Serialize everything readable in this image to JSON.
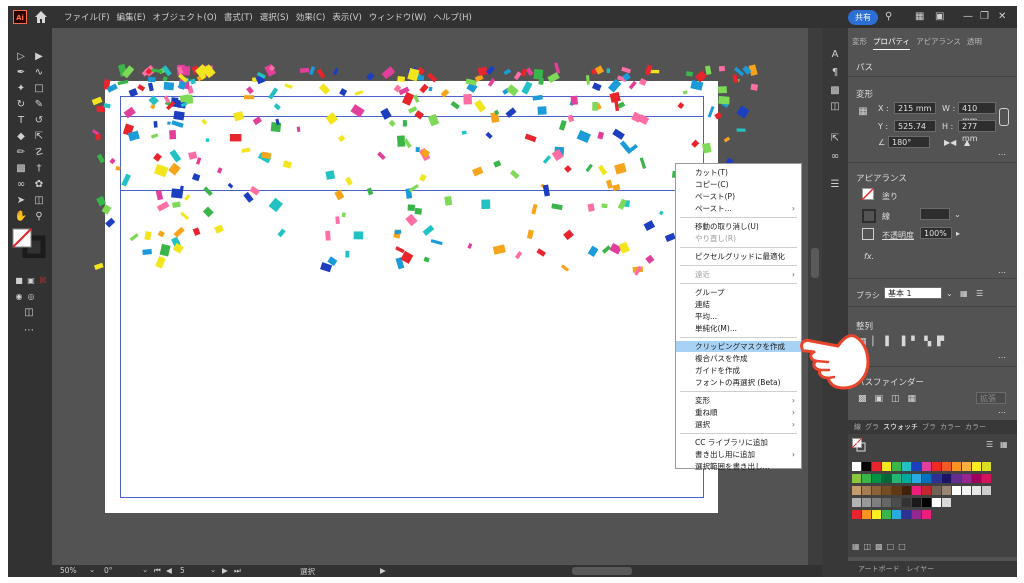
{
  "menubar": {
    "logo": "Ai",
    "menus": [
      "ファイル(F)",
      "編集(E)",
      "オブジェクト(O)",
      "書式(T)",
      "選択(S)",
      "効果(C)",
      "表示(V)",
      "ウィンドウ(W)",
      "ヘルプ(H)"
    ],
    "share": "共有"
  },
  "context_menu": {
    "items": [
      {
        "label": "カット(T)",
        "disabled": false,
        "submenu": false
      },
      {
        "label": "コピー(C)",
        "disabled": false,
        "submenu": false
      },
      {
        "label": "ペースト(P)",
        "disabled": false,
        "submenu": false
      },
      {
        "label": "ペースト...",
        "disabled": false,
        "submenu": true
      },
      {
        "label": "移動の取り消し(U)",
        "disabled": false,
        "submenu": false
      },
      {
        "label": "やり直し(R)",
        "disabled": true,
        "submenu": false
      },
      {
        "label": "ピクセルグリッドに最適化",
        "disabled": false,
        "submenu": false
      },
      {
        "label": "遠近",
        "disabled": true,
        "submenu": true
      },
      {
        "label": "グループ",
        "disabled": false,
        "submenu": false
      },
      {
        "label": "連結",
        "disabled": false,
        "submenu": false
      },
      {
        "label": "平均...",
        "disabled": false,
        "submenu": false
      },
      {
        "label": "単純化(M)...",
        "disabled": false,
        "submenu": false
      },
      {
        "label": "クリッピングマスクを作成",
        "disabled": false,
        "submenu": false,
        "highlight": true
      },
      {
        "label": "複合パスを作成",
        "disabled": false,
        "submenu": false
      },
      {
        "label": "ガイドを作成",
        "disabled": false,
        "submenu": false
      },
      {
        "label": "フォントの再選択 (Beta)",
        "disabled": false,
        "submenu": false
      },
      {
        "label": "変形",
        "disabled": false,
        "submenu": true
      },
      {
        "label": "重ね順",
        "disabled": false,
        "submenu": true
      },
      {
        "label": "選択",
        "disabled": false,
        "submenu": true
      },
      {
        "label": "CC ライブラリに追加",
        "disabled": false,
        "submenu": false
      },
      {
        "label": "書き出し用に追加",
        "disabled": false,
        "submenu": true
      },
      {
        "label": "選択範囲を書き出し...",
        "disabled": false,
        "submenu": false
      }
    ]
  },
  "properties": {
    "tabs": [
      "変形",
      "プロパティ",
      "アピアランス",
      "透明"
    ],
    "section_path": "パス",
    "transform_title": "変形",
    "x_label": "X :",
    "x_value": "215 mm",
    "y_label": "Y :",
    "y_value": "525.74",
    "w_label": "W :",
    "w_value": "410 mm",
    "h_label": "H :",
    "h_value": "277 mm",
    "angle_value": "180°",
    "appearance_title": "アピアランス",
    "fill_label": "塗り",
    "stroke_label": "線",
    "opacity_label": "不透明度",
    "opacity_value": "100%",
    "fx_label": "fx.",
    "brush_label": "ブラシ",
    "brush_value": "基本",
    "brush_size": "1",
    "align_title": "整列",
    "pathfinder_title": "パスファインダー",
    "pathfinder_expand": "拡張"
  },
  "swatches": {
    "tabs": [
      "線",
      "グラ",
      "スウォッチ",
      "ブラ",
      "カラー",
      "カラー"
    ]
  },
  "layers": {
    "tabs": [
      "アートボード",
      "レイヤー"
    ]
  },
  "statusbar": {
    "zoom": "50%",
    "rotation": "0°",
    "artboard": "5",
    "tool": "選択"
  }
}
